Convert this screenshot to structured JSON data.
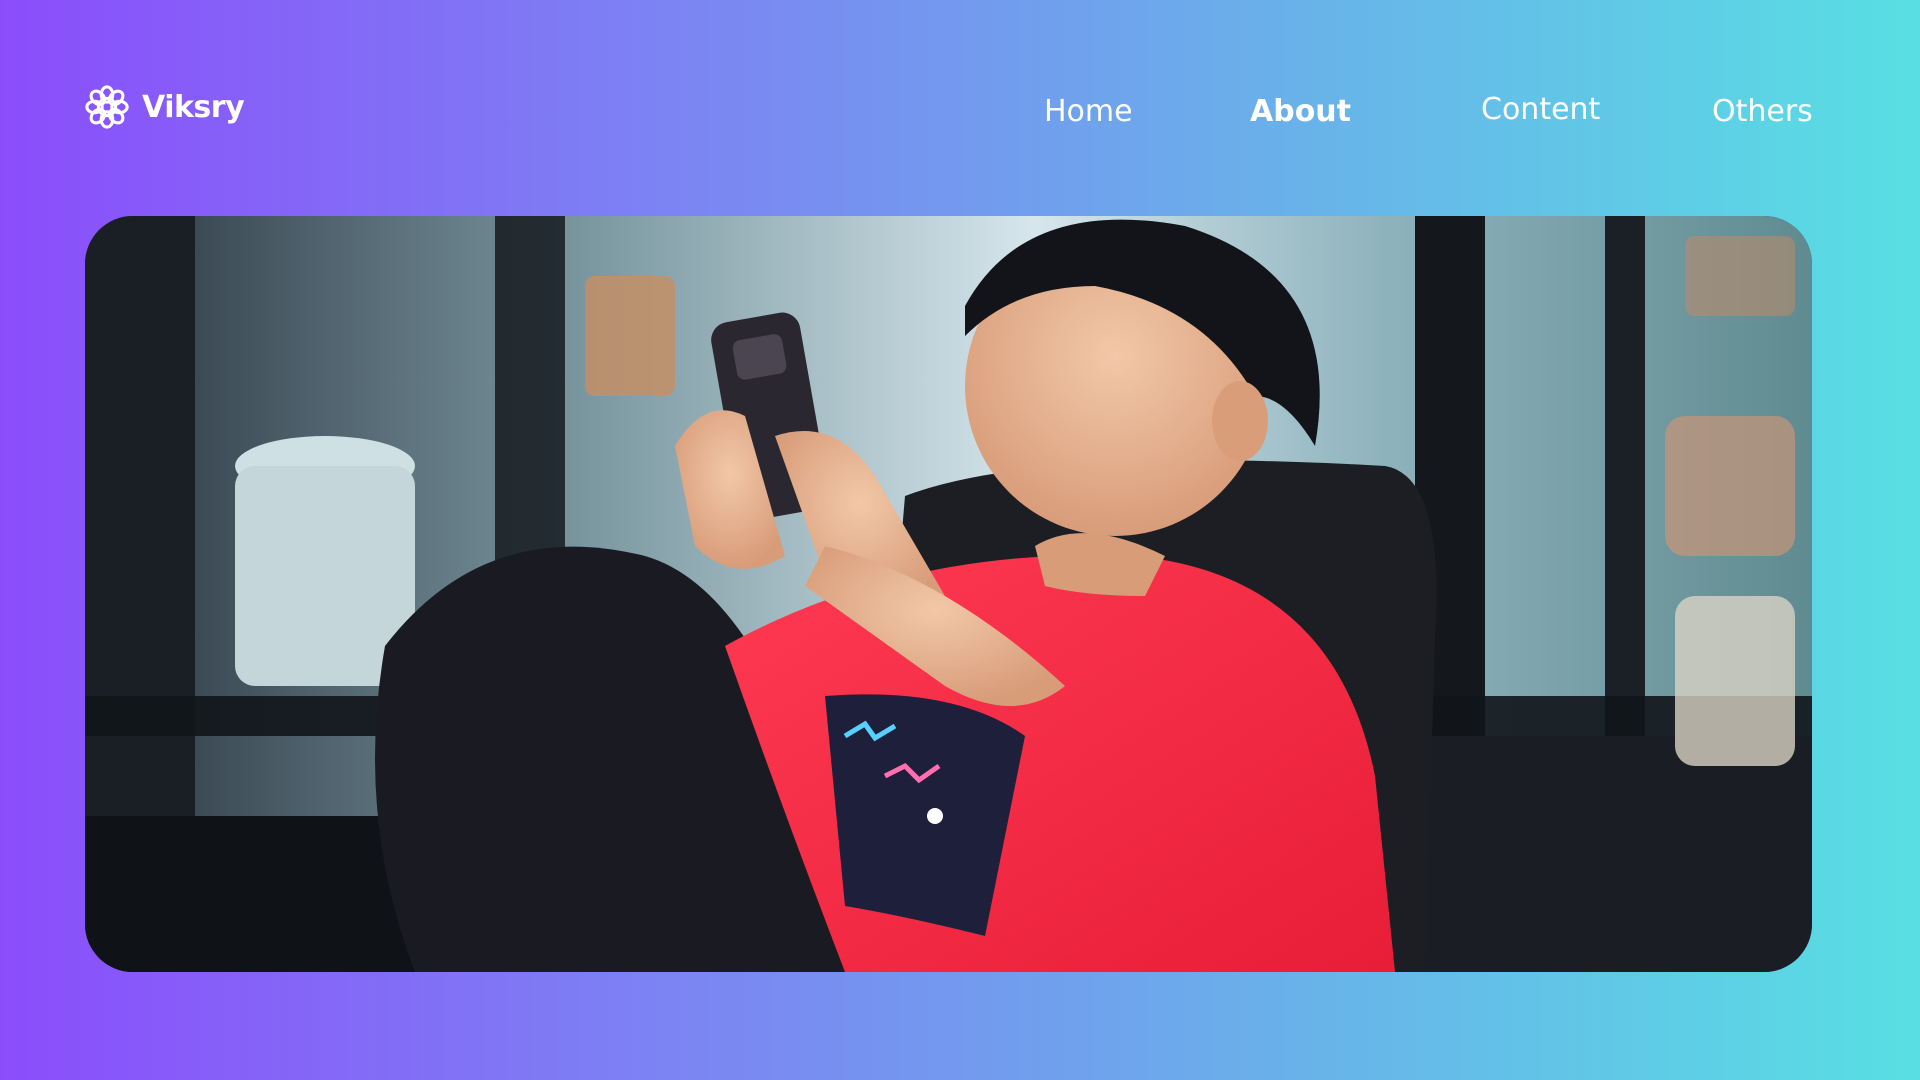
{
  "brand": {
    "name": "Viksry",
    "logo_icon": "flower-outline-icon"
  },
  "nav": {
    "items": [
      {
        "id": "home",
        "label": "Home",
        "active": false
      },
      {
        "id": "about",
        "label": "About",
        "active": true
      },
      {
        "id": "content",
        "label": "Content",
        "active": false
      },
      {
        "id": "others",
        "label": "Others",
        "active": false
      }
    ]
  },
  "colors": {
    "gradient_start": "#8b4dfb",
    "gradient_end": "#58dfe3",
    "text": "#ffffff",
    "shirt_red": "#f4243f"
  }
}
